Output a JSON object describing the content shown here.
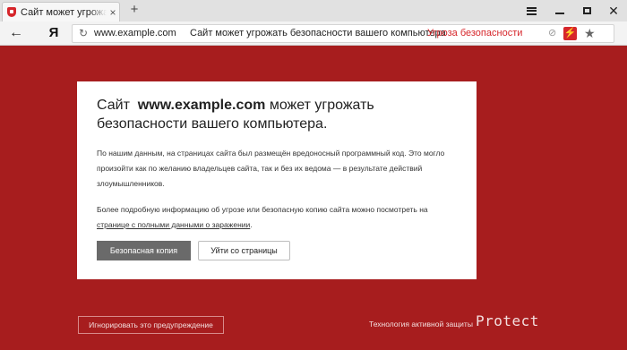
{
  "tab": {
    "title": "Сайт может угрожать бе",
    "close": "×",
    "new_tab": "+"
  },
  "window_controls": {
    "close": "✕"
  },
  "navbar": {
    "back": "←",
    "yandex_button": "Я",
    "reload": "↻",
    "url": "www.example.com",
    "page_title": "Сайт может угрожать безопасности вашего компьютера",
    "threat_label": "Угроза безопасности",
    "protect_icon": "⊘",
    "flash_icon": "⚡",
    "bookmark_icon": "★",
    "download_icon": "⬇"
  },
  "warning": {
    "heading_prefix": "Сайт",
    "domain": "www.example.com",
    "heading_suffix": "может угрожать безопасности вашего компьютера.",
    "paragraph1": "По нашим данным, на страницах сайта был размещён вредоносный программный код. Это могло произойти как по желанию владельцев сайта, так и без их ведома — в результате действий злоумышленников.",
    "paragraph2_text": "Более подробную информацию об угрозе или безопасную копию сайта можно посмотреть на ",
    "paragraph2_link": "странице с полными данными о заражении",
    "paragraph2_end": ".",
    "safe_copy_button": "Безопасная копия",
    "leave_button": "Уйти со страницы"
  },
  "footer": {
    "ignore_button": "Игнорировать это предупреждение",
    "technology_text": "Технология активной защиты",
    "brand": "Protect"
  },
  "colors": {
    "background_red": "#a71d1e",
    "threat_red": "#d6262b",
    "safe_button": "#6a6a6a"
  }
}
